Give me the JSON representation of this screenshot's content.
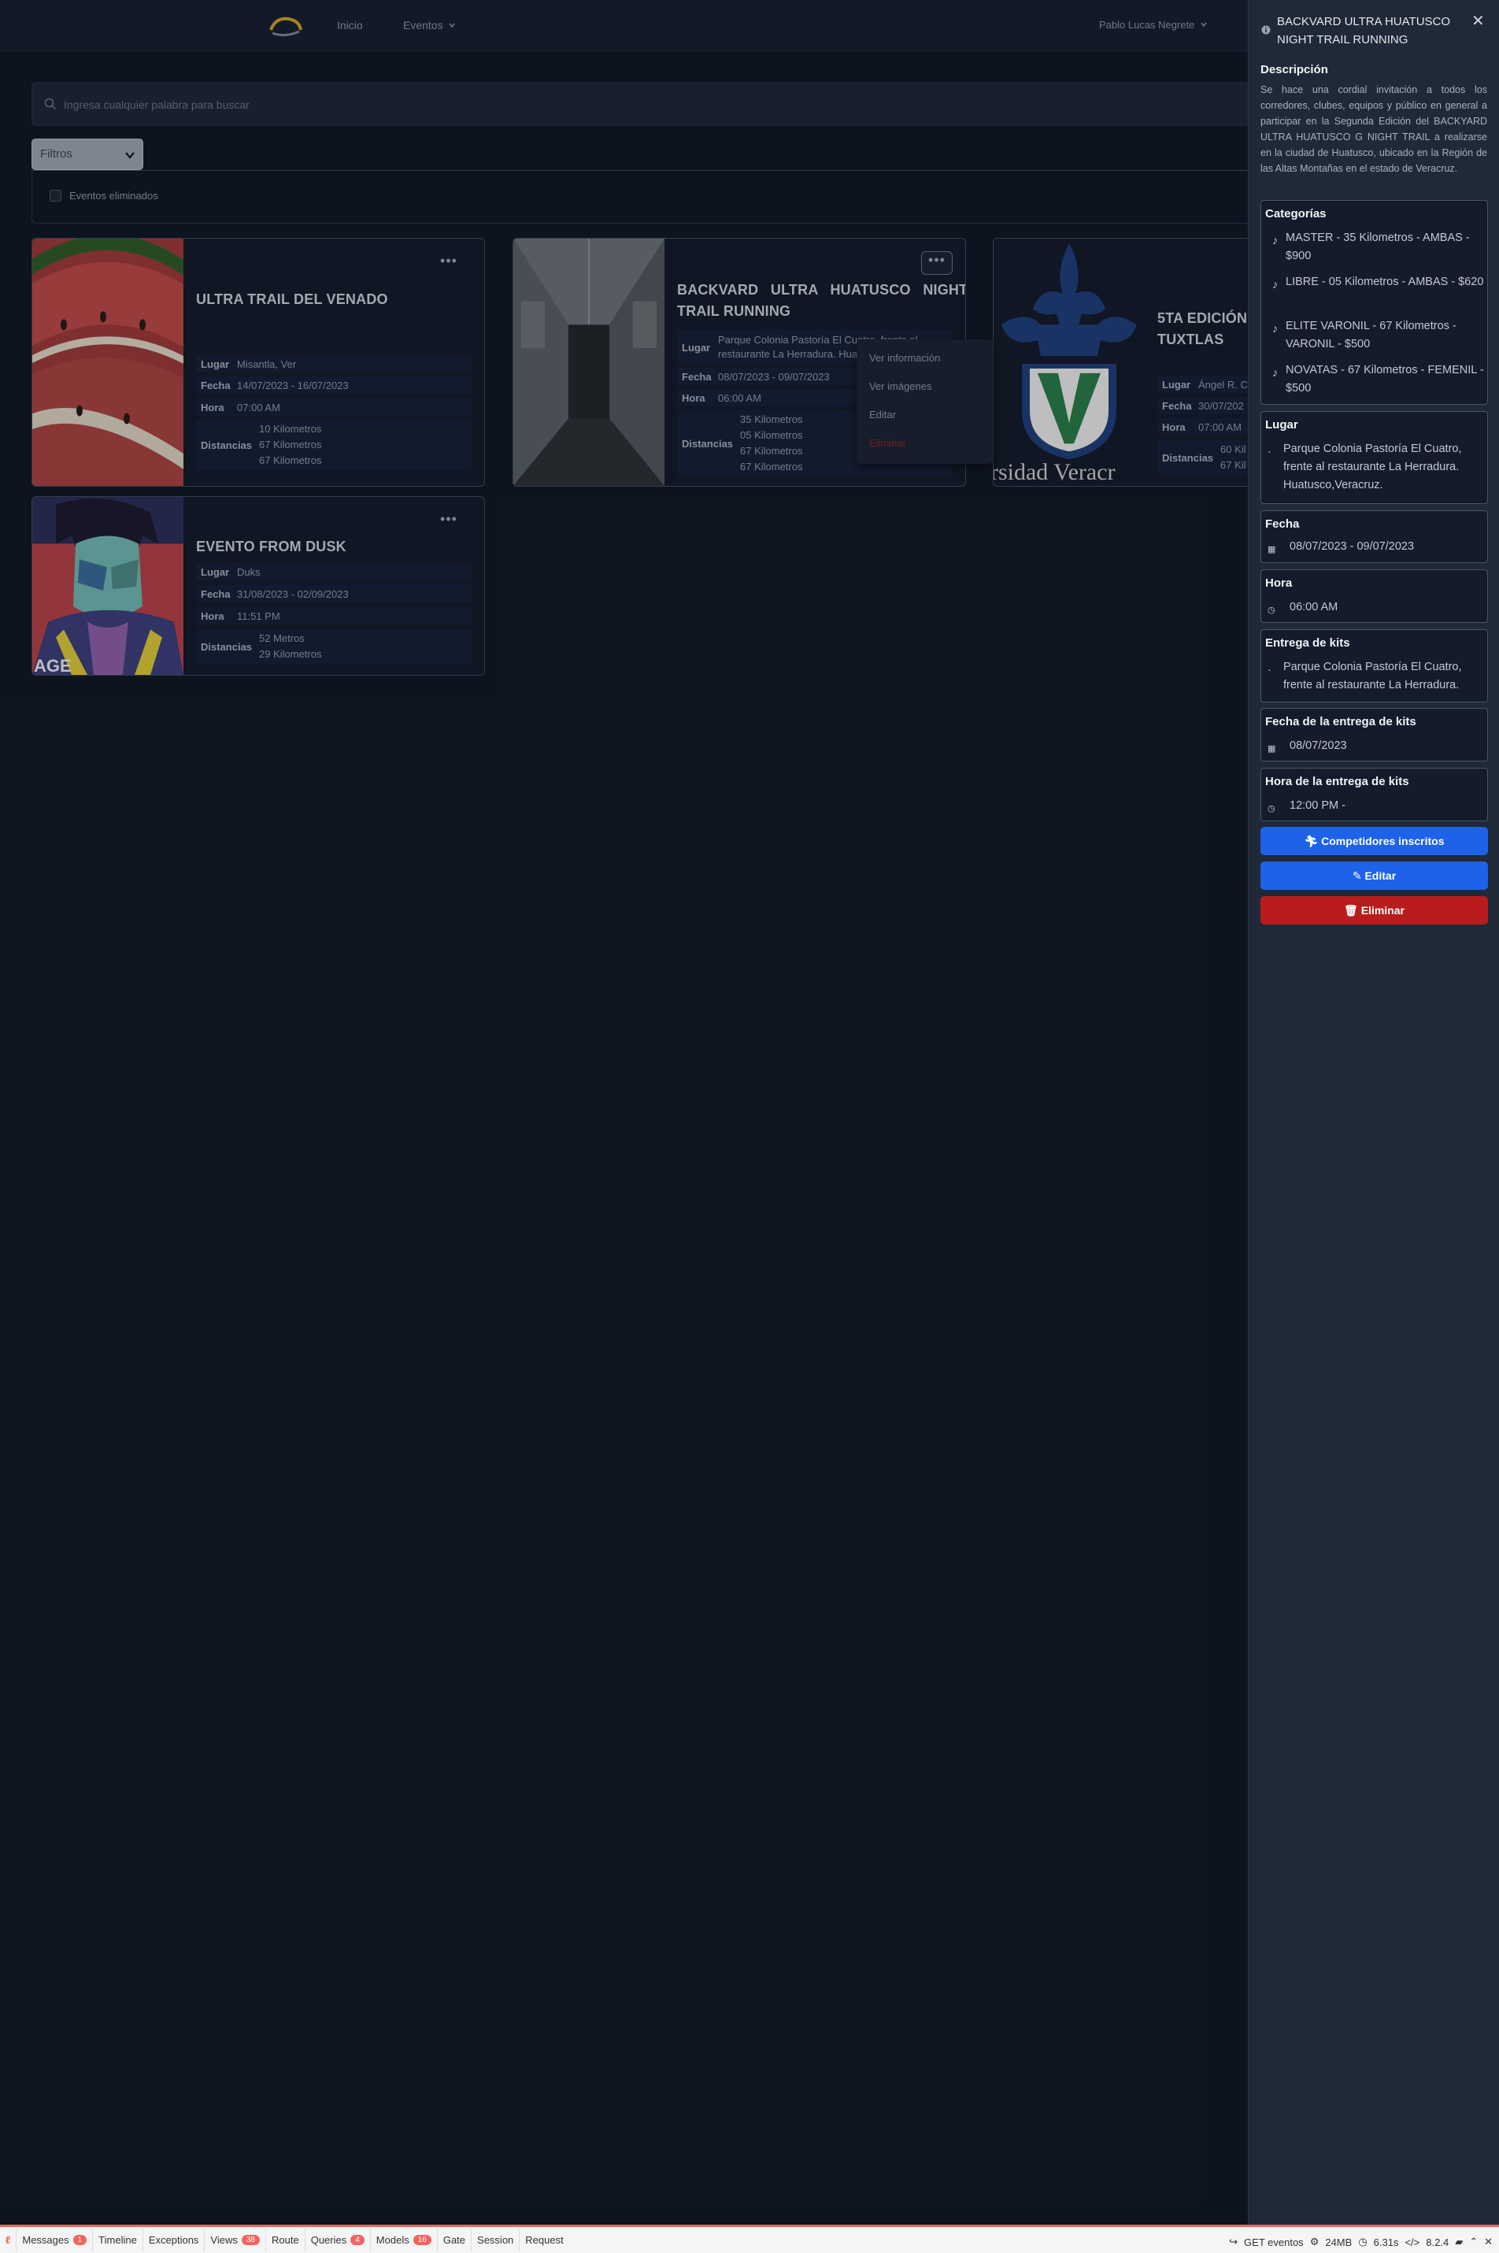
{
  "nav": {
    "home": "Inicio",
    "events": "Eventos",
    "user": "Pablo Lucas Negrete"
  },
  "search": {
    "placeholder": "Ingresa cualquier palabra para buscar"
  },
  "filters": {
    "select_label": "Filtros",
    "deleted_label": "Eventos eliminados"
  },
  "labels": {
    "place": "Lugar",
    "date": "Fecha",
    "time": "Hora",
    "distances": "Distancias"
  },
  "cards": [
    {
      "title": "ULTRA TRAIL DEL VENADO",
      "place": "Misantla, Ver",
      "date": "14/07/2023 - 16/07/2023",
      "time": "07:00 AM",
      "distances": [
        "10 Kilometros",
        "67 Kilometros",
        "67 Kilometros"
      ]
    },
    {
      "title": "BACKVARD ULTRA HUATUSCO NIGHT TRAIL RUNNING",
      "title_line1": "BACKVARD   ULTRA   HUATUSCO   NIGHT",
      "title_line2": "TRAIL RUNNING",
      "place_line1": "Parque Colonia Pastoría El Cuatro, frente al",
      "place_line2": "restaurante La Herradura. Huatusco,Veracruz.",
      "date": "08/07/2023 - 09/07/2023",
      "time": "06:00 AM",
      "distances": [
        "35 Kilometros",
        "05 Kilometros",
        "67 Kilometros",
        "67 Kilometros"
      ]
    },
    {
      "title_line1": "5TA EDICIÓN",
      "title_line2": "TUXTLAS",
      "place": "Ángel R. C",
      "date": "30/07/202",
      "time": "07:00 AM",
      "distances": [
        "60 Kil",
        "67 Kil"
      ],
      "image_text": "rsidad Veracr"
    },
    {
      "title": "EVENTO FROM DUSK",
      "place": "Duks",
      "date": "31/08/2023 - 02/09/2023",
      "time": "11:51 PM",
      "distances": [
        "52 Metros",
        "29 Kilometros"
      ],
      "image_text": "AGE"
    }
  ],
  "context_menu": {
    "view_info": "Ver información",
    "view_images": "Ver imágenes",
    "edit": "Editar",
    "delete": "Eliminar"
  },
  "side_panel": {
    "title": "BACKVARD ULTRA HUATUSCO NIGHT TRAIL RUNNING",
    "desc_title": "Descripción",
    "description": "Se hace una cordial invitación a todos los corredores, clubes, equipos y público en general a participar en la Segunda Edición del BACKYARD ULTRA HUATUSCO G NIGHT TRAIL a realizarse en la ciudad de Huatusco, ubicado en la Región de las Altas Montañas en el estado de Veracruz.",
    "categories_title": "Categorías",
    "categories": [
      "MASTER - 35 Kilometros - AMBAS - $900",
      "LIBRE - 05 Kilometros - AMBAS - $620",
      "ELITE VARONIL - 67 Kilometros - VARONIL - $500",
      "NOVATAS - 67 Kilometros - FEMENIL - $500"
    ],
    "place_title": "Lugar",
    "place": "Parque Colonia Pastoría El Cuatro, frente al restaurante La Herradura. Huatusco,Veracruz.",
    "date_title": "Fecha",
    "date": "08/07/2023 - 09/07/2023",
    "time_title": "Hora",
    "time": "06:00 AM",
    "kits_title": "Entrega de kits",
    "kits_place": "Parque Colonia Pastoría El Cuatro, frente al restaurante La Herradura.",
    "kits_date_title": "Fecha de la entrega de kits",
    "kits_date": "08/07/2023",
    "kits_time_title": "Hora de la entrega de kits",
    "kits_time": "12:00 PM -",
    "btn_competitors": "Competidores inscritos",
    "btn_edit": "Editar",
    "btn_delete": "Eliminar"
  },
  "debugbar": {
    "messages": "Messages",
    "messages_count": "1",
    "timeline": "Timeline",
    "exceptions": "Exceptions",
    "views": "Views",
    "views_count": "38",
    "route": "Route",
    "queries": "Queries",
    "queries_count": "4",
    "models": "Models",
    "models_count": "16",
    "gate": "Gate",
    "session": "Session",
    "request": "Request",
    "route_info": "GET eventos",
    "memory": "24MB",
    "duration": "6.31s",
    "php_version": "8.2.4"
  },
  "colors": {
    "background": "#111827",
    "panel": "#1f2937",
    "primary": "#1d62e8",
    "danger": "#b91c1c"
  }
}
